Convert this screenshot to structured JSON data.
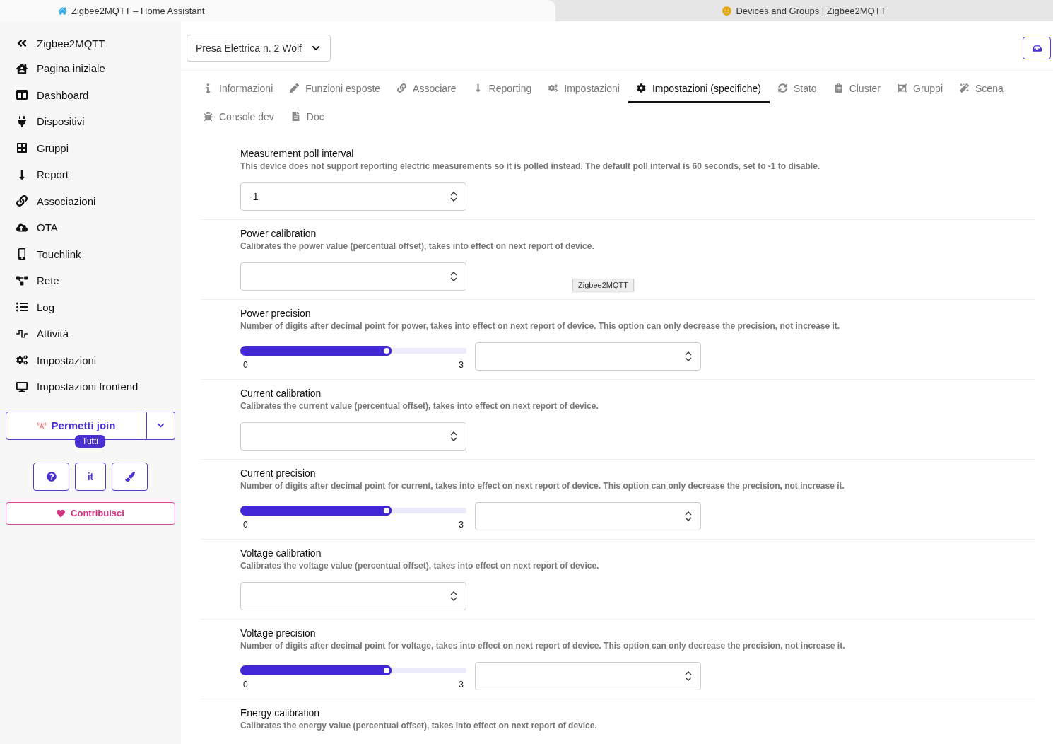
{
  "browser_tabs": [
    {
      "title": "Zigbee2MQTT – Home Assistant",
      "selected": true
    },
    {
      "title": "Devices and Groups | Zigbee2MQTT",
      "selected": false
    }
  ],
  "sidebar": {
    "title": "Zigbee2MQTT",
    "items": [
      {
        "label": "Pagina iniziale"
      },
      {
        "label": "Dashboard"
      },
      {
        "label": "Dispositivi"
      },
      {
        "label": "Gruppi"
      },
      {
        "label": "Report"
      },
      {
        "label": "Associazioni"
      },
      {
        "label": "OTA"
      },
      {
        "label": "Touchlink"
      },
      {
        "label": "Rete"
      },
      {
        "label": "Log"
      },
      {
        "label": "Attività"
      },
      {
        "label": "Impostazioni"
      },
      {
        "label": "Impostazioni frontend"
      }
    ],
    "permit_join": {
      "label": "Permetti join",
      "badge": "Tutti"
    },
    "language": "it",
    "donate": "Contribuisci"
  },
  "device_select": {
    "value": "Presa Elettrica n. 2 Wolf"
  },
  "tabs": [
    {
      "label": "Informazioni",
      "selected": false
    },
    {
      "label": "Funzioni esposte",
      "selected": false
    },
    {
      "label": "Associare",
      "selected": false
    },
    {
      "label": "Reporting",
      "selected": false
    },
    {
      "label": "Impostazioni",
      "selected": false
    },
    {
      "label": "Impostazioni (specifiche)",
      "selected": true
    },
    {
      "label": "Stato",
      "selected": false
    },
    {
      "label": "Cluster",
      "selected": false
    },
    {
      "label": "Gruppi",
      "selected": false
    },
    {
      "label": "Scena",
      "selected": false
    },
    {
      "label": "Console dev",
      "selected": false
    },
    {
      "label": "Doc",
      "selected": false
    }
  ],
  "tooltip": "Zigbee2MQTT",
  "settings": [
    {
      "kind": "number",
      "title": "Measurement poll interval",
      "description": "This device does not support reporting electric measurements so it is polled instead. The default poll interval is 60 seconds, set to -1 to disable.",
      "value": "-1"
    },
    {
      "kind": "number",
      "title": "Power calibration",
      "description": "Calibrates the power value (percentual offset), takes into effect on next report of device."
    },
    {
      "kind": "slider",
      "title": "Power precision",
      "description": "Number of digits after decimal point for power, takes into effect on next report of device. This option can only decrease the precision, not increase it.",
      "level": 0.67,
      "min": "0",
      "max": "3"
    },
    {
      "kind": "number",
      "title": "Current calibration",
      "description": "Calibrates the current value (percentual offset), takes into effect on next report of device."
    },
    {
      "kind": "slider",
      "title": "Current precision",
      "description": "Number of digits after decimal point for current, takes into effect on next report of device. This option can only decrease the precision, not increase it.",
      "level": 0.67,
      "min": "0",
      "max": "3"
    },
    {
      "kind": "number",
      "title": "Voltage calibration",
      "description": "Calibrates the voltage value (percentual offset), takes into effect on next report of device."
    },
    {
      "kind": "slider",
      "title": "Voltage precision",
      "description": "Number of digits after decimal point for voltage, takes into effect on next report of device. This option can only decrease the precision, not increase it.",
      "level": 0.67,
      "min": "0",
      "max": "3"
    },
    {
      "kind": "label",
      "title": "Energy calibration",
      "description": "Calibrates the energy value (percentual offset), takes into effect on next report of device."
    }
  ]
}
